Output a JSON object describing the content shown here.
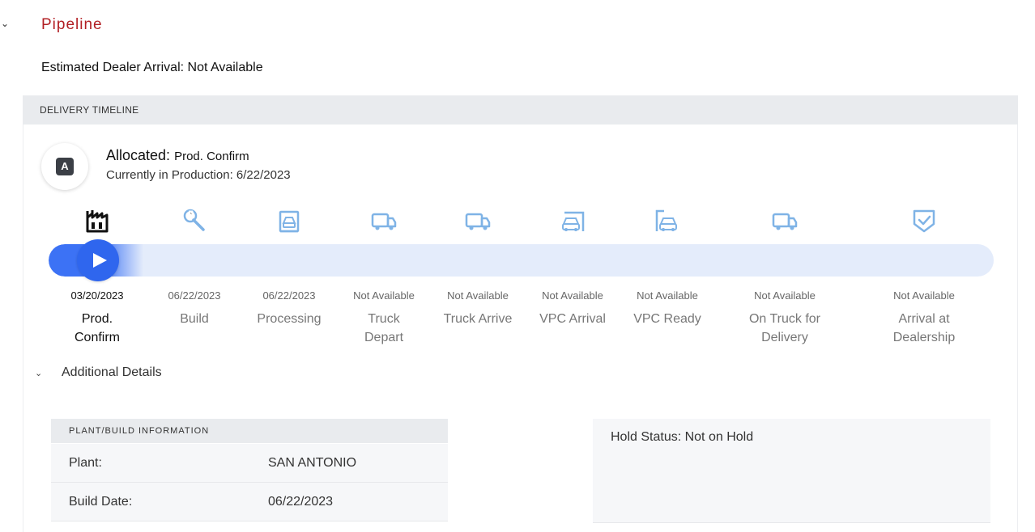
{
  "pipeline": {
    "title": "Pipeline",
    "estimated_arrival": "Estimated Dealer Arrival: Not Available"
  },
  "timeline": {
    "header": "DELIVERY TIMELINE",
    "badge": "A",
    "status_prefix": "Allocated:",
    "status_stage": "Prod. Confirm",
    "status_detail": "Currently in Production: 6/22/2023",
    "progress_fraction": 0.1,
    "steps": [
      {
        "date": "03/20/2023",
        "label": "Prod. Confirm",
        "icon": "factory-icon",
        "active": true
      },
      {
        "date": "06/22/2023",
        "label": "Build",
        "icon": "wrench-icon",
        "active": false
      },
      {
        "date": "06/22/2023",
        "label": "Processing",
        "icon": "processing-icon",
        "active": false
      },
      {
        "date": "Not Available",
        "label": "Truck Depart",
        "icon": "truck-icon",
        "active": false
      },
      {
        "date": "Not Available",
        "label": "Truck Arrive",
        "icon": "truck-icon",
        "active": false
      },
      {
        "date": "Not Available",
        "label": "VPC Arrival",
        "icon": "car-arrival-icon",
        "active": false
      },
      {
        "date": "Not Available",
        "label": "VPC Ready",
        "icon": "car-ready-icon",
        "active": false
      },
      {
        "date": "Not Available",
        "label": "On Truck for Delivery",
        "icon": "truck-icon",
        "active": false
      },
      {
        "date": "Not Available",
        "label": "Arrival at Dealership",
        "icon": "shield-check-icon",
        "active": false
      }
    ]
  },
  "additional_details": {
    "title": "Additional Details",
    "plant_info": {
      "header": "PLANT/BUILD INFORMATION",
      "rows": [
        {
          "key": "Plant:",
          "value": "SAN ANTONIO"
        },
        {
          "key": "Build Date:",
          "value": "06/22/2023"
        }
      ]
    },
    "hold_status": "Hold Status: Not on Hold"
  },
  "colors": {
    "brand_red": "#b21f24",
    "progress_blue": "#2f66ee",
    "icon_inactive": "#7fb3e6",
    "icon_active": "#111111"
  }
}
